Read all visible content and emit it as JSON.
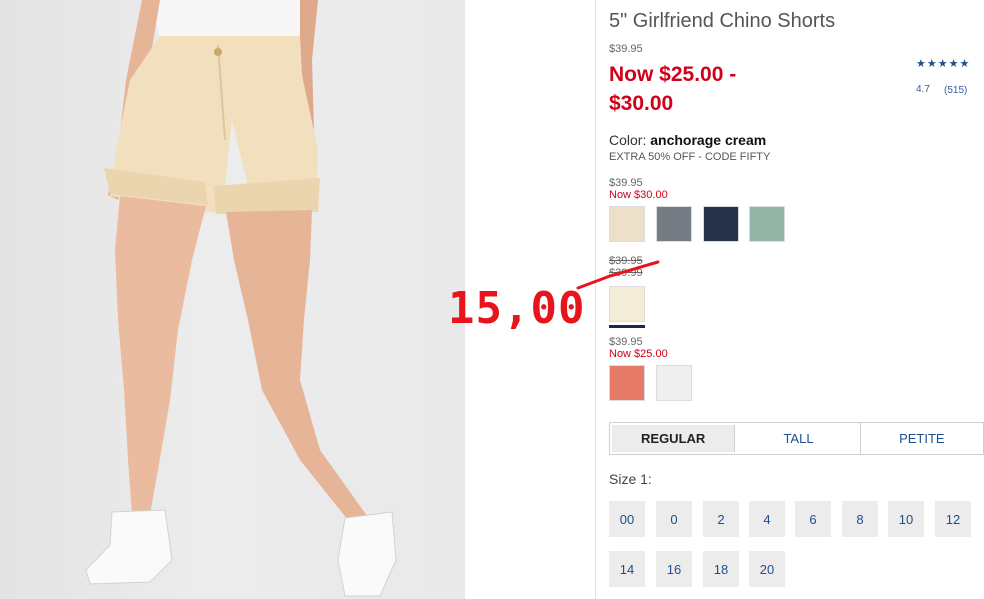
{
  "product": {
    "title": "5\" Girlfriend Chino Shorts",
    "original_price": "$39.95",
    "now_price": "Now $25.00 - $30.00",
    "rating": {
      "stars": 5,
      "value": "4.7",
      "count": "(515)",
      "star_color": "#1f4e8c"
    },
    "color_label": "Color:",
    "color_name": "anchorage cream",
    "promo": "EXTRA 50% OFF - CODE FIFTY"
  },
  "price_groups": [
    {
      "original": "$39.95",
      "now": "Now $30.00",
      "swatches": [
        {
          "name": "cream",
          "color": "#ede0c8"
        },
        {
          "name": "gray",
          "color": "#757c84"
        },
        {
          "name": "navy",
          "color": "#263247"
        },
        {
          "name": "sage",
          "color": "#93b5a8"
        }
      ]
    },
    {
      "original": "$39.95",
      "now": "$39.99",
      "swatches": [
        {
          "name": "anchorage cream",
          "color": "#f3ecd7",
          "selected": true
        }
      ]
    },
    {
      "original": "$39.95",
      "now": "Now $25.00",
      "swatches": [
        {
          "name": "coral",
          "color": "#e57a68"
        },
        {
          "name": "white",
          "color": "#efefef"
        }
      ]
    }
  ],
  "annotation": {
    "text": "15,00",
    "color": "#e8141c"
  },
  "fit_tabs": [
    {
      "label": "REGULAR",
      "active": true
    },
    {
      "label": "TALL",
      "active": false
    },
    {
      "label": "PETITE",
      "active": false
    }
  ],
  "size_label": "Size 1:",
  "sizes": [
    "00",
    "0",
    "2",
    "4",
    "6",
    "8",
    "10",
    "12",
    "14",
    "16",
    "18",
    "20"
  ],
  "colors": {
    "sale_red": "#d0021b",
    "link_blue": "#1f4e8c"
  }
}
